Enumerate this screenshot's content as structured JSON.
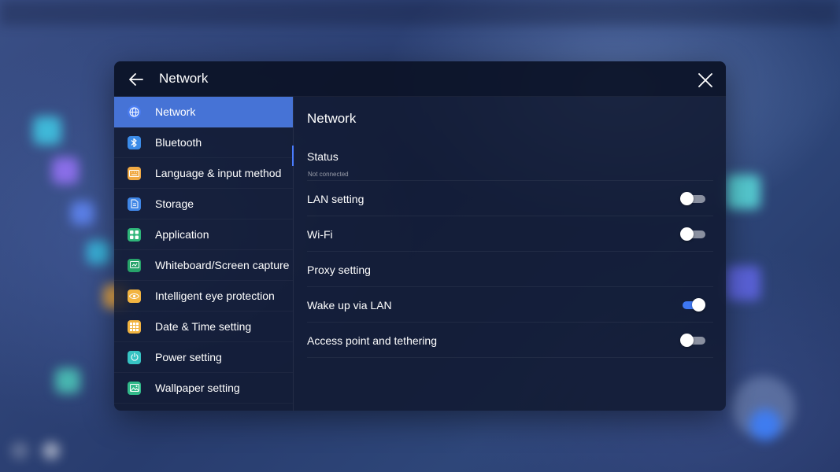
{
  "header": {
    "title": "Network",
    "back_icon": "arrow-left-icon",
    "close_icon": "close-icon"
  },
  "sidebar": {
    "items": [
      {
        "label": "Network",
        "icon": "globe-icon",
        "color": "#4a7cf0",
        "active": true
      },
      {
        "label": "Bluetooth",
        "icon": "bluetooth-icon",
        "color": "#3b8be8",
        "active": false
      },
      {
        "label": "Language & input method",
        "icon": "keyboard-icon",
        "color": "#f0a944",
        "active": false
      },
      {
        "label": "Storage",
        "icon": "document-icon",
        "color": "#3f86e6",
        "active": false
      },
      {
        "label": "Application",
        "icon": "apps-grid-icon",
        "color": "#2fb67a",
        "active": false
      },
      {
        "label": "Whiteboard/Screen capture",
        "icon": "screen-capture-icon",
        "color": "#27a36a",
        "active": false
      },
      {
        "label": "Intelligent eye protection",
        "icon": "eye-icon",
        "color": "#f2b441",
        "active": false
      },
      {
        "label": "Date & Time setting",
        "icon": "calendar-grid-icon",
        "color": "#f2b441",
        "active": false
      },
      {
        "label": "Power setting",
        "icon": "power-icon",
        "color": "#37c4c4",
        "active": false
      },
      {
        "label": "Wallpaper setting",
        "icon": "image-icon",
        "color": "#32b98a",
        "active": false
      }
    ]
  },
  "content": {
    "title": "Network",
    "status": {
      "label": "Status",
      "sub": "Not connected"
    },
    "rows": [
      {
        "label": "LAN setting",
        "toggle": true,
        "on": false
      },
      {
        "label": "Wi-Fi",
        "toggle": true,
        "on": false
      },
      {
        "label": "Proxy setting",
        "toggle": false
      },
      {
        "label": "Wake up via LAN",
        "toggle": true,
        "on": true
      },
      {
        "label": "Access point and tethering",
        "toggle": true,
        "on": false
      }
    ]
  },
  "colors": {
    "accent": "#4673d6",
    "toggle_on": "#3e77f2",
    "toggle_off": "#8a90a0"
  }
}
